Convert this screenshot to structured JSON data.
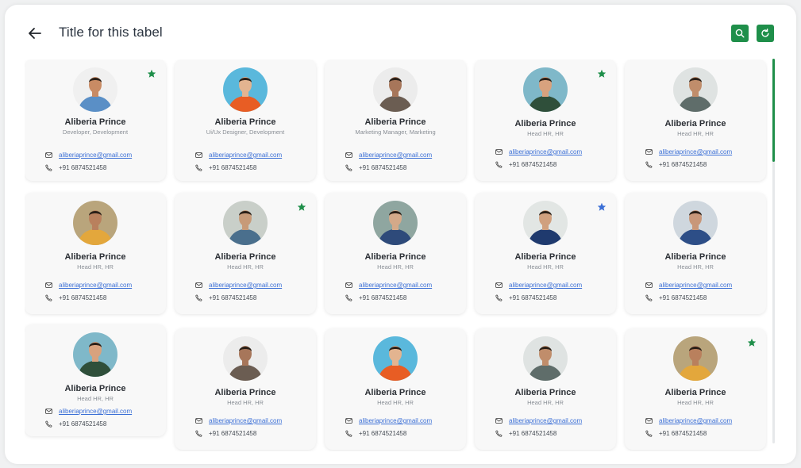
{
  "header": {
    "title": "Title for this tabel"
  },
  "colors": {
    "accent": "#1f8f4a",
    "link": "#3b6fd6",
    "star_blue": "#3b6fd6"
  },
  "icons": {
    "back": "arrow-left-icon",
    "search": "search-icon",
    "refresh": "refresh-icon",
    "email": "mail-icon",
    "phone": "phone-icon",
    "star": "star-icon"
  },
  "cards": [
    {
      "name": "Aliberia Prince",
      "role": "Developer, Development",
      "email": "aliberiaprince@gmail.com",
      "phone": "+91 6874521458",
      "star": "green",
      "avatar_bg": "#f0f0f0",
      "shirt": "#5a8fc6",
      "skin": "#c98b64"
    },
    {
      "name": "Aliberia Prince",
      "role": "Ui/Ux Designer, Development",
      "email": "aliberiaprince@gmail.com",
      "phone": "+91 6874521458",
      "star": "",
      "avatar_bg": "#5ab8dc",
      "shirt": "#e85d24",
      "skin": "#e3b490"
    },
    {
      "name": "Aliberia Prince",
      "role": "Marketing Manager, Marketing",
      "email": "aliberiaprince@gmail.com",
      "phone": "+91 6874521458",
      "star": "",
      "avatar_bg": "#ececec",
      "shirt": "#6b5d52",
      "skin": "#a7765a"
    },
    {
      "name": "Aliberia Prince",
      "role": "Head HR, HR",
      "email": "aliberiaprince@gmail.com",
      "phone": "+91 6874521458",
      "star": "green",
      "avatar_bg": "#7fb8c9",
      "shirt": "#2f4f3a",
      "skin": "#d8a27e"
    },
    {
      "name": "Aliberia Prince",
      "role": "Head HR, HR",
      "email": "aliberiaprince@gmail.com",
      "phone": "+91 6874521458",
      "star": "",
      "avatar_bg": "#dfe3e2",
      "shirt": "#5f6d6a",
      "skin": "#c08d6b"
    },
    {
      "name": "Aliberia Prince",
      "role": "Head HR, HR",
      "email": "aliberiaprince@gmail.com",
      "phone": "+91 6874521458",
      "star": "",
      "avatar_bg": "#b9a57c",
      "shirt": "#e3a73c",
      "skin": "#b9805d"
    },
    {
      "name": "Aliberia Prince",
      "role": "Head HR, HR",
      "email": "aliberiaprince@gmail.com",
      "phone": "+91 6874521458",
      "star": "green",
      "avatar_bg": "#c9cfc9",
      "shirt": "#4a6f8d",
      "skin": "#c79a78"
    },
    {
      "name": "Aliberia Prince",
      "role": "Head HR, HR",
      "email": "aliberiaprince@gmail.com",
      "phone": "+91 6874521458",
      "star": "",
      "avatar_bg": "#8fa6a0",
      "shirt": "#2e4a7a",
      "skin": "#d4a989"
    },
    {
      "name": "Aliberia Prince",
      "role": "Head HR, HR",
      "email": "aliberiaprince@gmail.com",
      "phone": "+91 6874521458",
      "star": "blue",
      "avatar_bg": "#e2e6e4",
      "shirt": "#1f3a6e",
      "skin": "#d0a07e"
    },
    {
      "name": "Aliberia Prince",
      "role": "Head HR, HR",
      "email": "aliberiaprince@gmail.com",
      "phone": "+91 6874521458",
      "star": "",
      "avatar_bg": "#cfd7de",
      "shirt": "#2d4e87",
      "skin": "#c8977a"
    },
    {
      "name": "Aliberia Prince",
      "role": "Head HR, HR",
      "email": "aliberiaprince@gmail.com",
      "phone": "+91 6874521458",
      "star": "",
      "avatar_bg": "#7fb8c9",
      "shirt": "#2f4f3a",
      "skin": "#d8a27e"
    },
    {
      "name": "Aliberia Prince",
      "role": "Head HR, HR",
      "email": "aliberiaprince@gmail.com",
      "phone": "+91 6874521458",
      "star": "",
      "avatar_bg": "#ececec",
      "shirt": "#6b5d52",
      "skin": "#a7765a"
    },
    {
      "name": "Aliberia Prince",
      "role": "Head HR, HR",
      "email": "aliberiaprince@gmail.com",
      "phone": "+91 6874521458",
      "star": "",
      "avatar_bg": "#5ab8dc",
      "shirt": "#e85d24",
      "skin": "#e3b490"
    },
    {
      "name": "Aliberia Prince",
      "role": "Head HR, HR",
      "email": "aliberiaprince@gmail.com",
      "phone": "+91 6874521458",
      "star": "",
      "avatar_bg": "#dfe3e2",
      "shirt": "#5f6d6a",
      "skin": "#c08d6b"
    },
    {
      "name": "Aliberia Prince",
      "role": "Head HR, HR",
      "email": "aliberiaprince@gmail.com",
      "phone": "+91 6874521458",
      "star": "green",
      "avatar_bg": "#b9a57c",
      "shirt": "#e3a73c",
      "skin": "#b9805d"
    }
  ]
}
